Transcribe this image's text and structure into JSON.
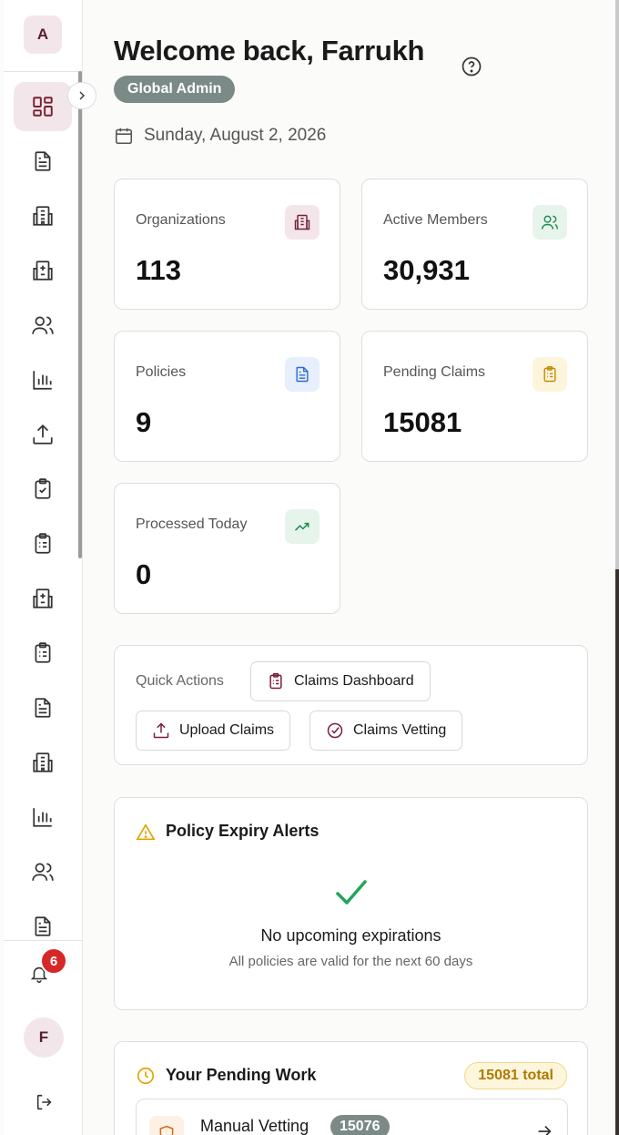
{
  "sidebar": {
    "org_initial": "A",
    "user_initial": "F",
    "notification_count": "6",
    "items": [
      {
        "icon": "dashboard-icon",
        "active": true
      },
      {
        "icon": "document-icon"
      },
      {
        "icon": "building-icon"
      },
      {
        "icon": "hospital-icon"
      },
      {
        "icon": "users-icon"
      },
      {
        "icon": "bar-chart-icon"
      },
      {
        "icon": "upload-icon"
      },
      {
        "icon": "clipboard-check-icon"
      },
      {
        "icon": "clipboard-list-icon"
      },
      {
        "icon": "hospital-icon"
      },
      {
        "icon": "clipboard-list-icon"
      },
      {
        "icon": "document-icon"
      },
      {
        "icon": "building-icon"
      },
      {
        "icon": "bar-chart-icon"
      },
      {
        "icon": "users-icon"
      },
      {
        "icon": "document-icon"
      }
    ]
  },
  "header": {
    "title": "Welcome back, Farrukh",
    "role_badge": "Global Admin",
    "date": "Sunday, August 2, 2026"
  },
  "stats": [
    {
      "label": "Organizations",
      "value": "113",
      "icon": "building-icon",
      "tint": "#f3e6ea",
      "color": "#7a1f36"
    },
    {
      "label": "Active Members",
      "value": "30,931",
      "icon": "users-icon",
      "tint": "#e6f4ec",
      "color": "#1f8a4c"
    },
    {
      "label": "Policies",
      "value": "9",
      "icon": "document-icon",
      "tint": "#e6effb",
      "color": "#2c6bd1"
    },
    {
      "label": "Pending Claims",
      "value": "15081",
      "icon": "clipboard-list-icon",
      "tint": "#fdf4dc",
      "color": "#c48a00"
    },
    {
      "label": "Processed Today",
      "value": "0",
      "icon": "trending-up-icon",
      "tint": "#e6f4ec",
      "color": "#1f8a4c"
    }
  ],
  "quick_actions": {
    "label": "Quick Actions",
    "buttons": [
      "Claims Dashboard",
      "Upload Claims",
      "Claims Vetting"
    ]
  },
  "policy_alerts": {
    "title": "Policy Expiry Alerts",
    "empty_title": "No upcoming expirations",
    "empty_sub": "All policies are valid for the next 60 days"
  },
  "pending_work": {
    "title": "Your Pending Work",
    "total": "15081 total",
    "items": [
      {
        "label": "Manual Vetting",
        "count": "15076"
      }
    ]
  },
  "colors": {
    "accent": "#7a1f36",
    "badge_gray": "#7b8a86",
    "warning": "#e0a300",
    "success": "#22a55a"
  }
}
